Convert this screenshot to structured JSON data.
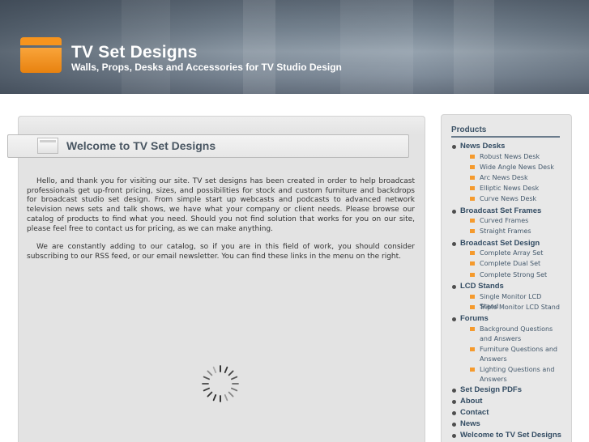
{
  "header": {
    "title": "TV Set Designs",
    "tagline": "Walls, Props, Desks and Accessories for TV Studio Design"
  },
  "main": {
    "title": "Welcome to TV Set Designs",
    "paragraphs": [
      "Hello, and thank you for visiting our site. TV set designs has been created in order to help broadcast professionals get up-front pricing, sizes, and possibilities for stock and custom furniture and backdrops for broadcast studio set design. From simple start up webcasts and podcasts to advanced network television news sets and talk shows, we have what your company or client needs. Please browse our catalog of products to find what you need. Should you not find solution that works for you on our site, please feel free to contact us for pricing, as we can make anything.",
      "We are constantly adding to our catalog, so if you are in this field of work, you should consider subscribing to our RSS feed, or our email newsletter. You can find these links in the menu on the right."
    ]
  },
  "sidebar": {
    "heading": "Products",
    "news_desks": {
      "label": "News Desks",
      "items": [
        "Robust News Desk",
        "Wide Angle News Desk",
        "Arc News Desk",
        "Elliptic News Desk",
        "Curve News Desk"
      ]
    },
    "frames": {
      "label": "Broadcast Set Frames",
      "items": [
        "Curved Frames",
        "Straight Frames"
      ]
    },
    "set_design": {
      "label": "Broadcast Set Design",
      "items": [
        "Complete Array Set",
        "Complete Dual Set",
        "Complete Strong Set"
      ]
    },
    "lcd": {
      "label": "LCD Stands",
      "items": [
        "Single Monitor LCD Stand",
        "Triple Monitor LCD Stand"
      ]
    },
    "forums": {
      "label": "Forums",
      "items": [
        "Background Questions and Answers",
        "Furniture Questions and Answers",
        "Lighting Questions and Answers"
      ]
    },
    "links": [
      "Set Design PDFs",
      "About",
      "Contact",
      "News",
      "Welcome to TV Set Designs"
    ]
  },
  "colors": {
    "accent": "#f7941d",
    "nav_text": "#334c63",
    "title_text": "#4a5763"
  }
}
